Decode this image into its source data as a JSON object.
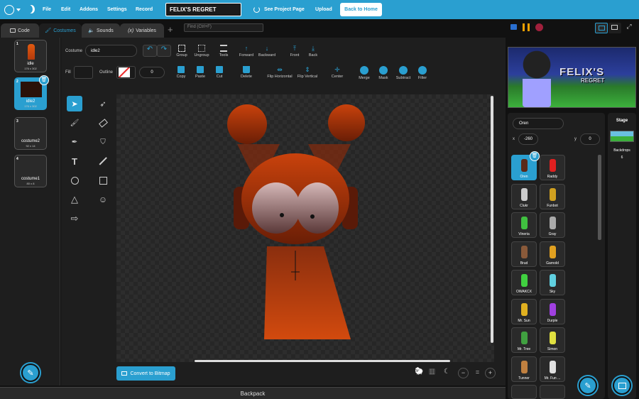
{
  "menu": {
    "file": "File",
    "edit": "Edit",
    "addons": "Addons",
    "settings": "Settings",
    "record": "Record",
    "project_title": "FELIX'S REGRET",
    "see_page": "See Project Page",
    "upload": "Upload",
    "back_home": "Back to Home"
  },
  "tabs": {
    "code": "Code",
    "costumes": "Costumes",
    "sounds": "Sounds",
    "variables": "Variables",
    "find_placeholder": "Find (Ctrl+F)"
  },
  "costumes": [
    {
      "num": "1",
      "name": "idle",
      "size": "176 x 302"
    },
    {
      "num": "2",
      "name": "idle2",
      "size": "176 x 302"
    },
    {
      "num": "3",
      "name": "costume2",
      "size": "92 x 14"
    },
    {
      "num": "4",
      "name": "costume1",
      "size": "80 x 8"
    }
  ],
  "editor": {
    "costume_label": "Costume",
    "costume_name": "idle2",
    "fill_label": "Fill",
    "outline_label": "Outline",
    "outline_width": "0",
    "group": "Group",
    "ungroup": "Ungroup",
    "tools": "Tools",
    "forward": "Forward",
    "backward": "Backward",
    "front": "Front",
    "back": "Back",
    "copy": "Copy",
    "paste": "Paste",
    "cut": "Cut",
    "delete": "Delete",
    "flip_h": "Flip Horizontal",
    "flip_v": "Flip Vertical",
    "center": "Center",
    "merge": "Merge",
    "mask": "Mask",
    "subtract": "Subtract",
    "filter": "Filter",
    "convert": "Convert to Bitmap"
  },
  "backpack": "Backpack",
  "stage_preview": {
    "banner": "FELIX'S",
    "sub": "REGRET"
  },
  "sprite_info": {
    "name": "Oren",
    "x_label": "x",
    "x": "-260",
    "y_label": "y",
    "y": "0"
  },
  "sprites": [
    "Oren",
    "Raddy",
    "Clukr",
    "Funbot",
    "Vineria",
    "Gray",
    "Brud",
    "Garnold",
    "OWAKCX",
    "Sky",
    "Mr. Sun",
    "Durple",
    "Mr. Tree",
    "Simon",
    "Tunner",
    "Mr. Fun ..."
  ],
  "stage_panel": {
    "title": "Stage",
    "backdrops_label": "Backdrops",
    "backdrops_count": "6"
  },
  "colors": {
    "accent": "#2a9fd0",
    "char": "#b33a0c"
  }
}
